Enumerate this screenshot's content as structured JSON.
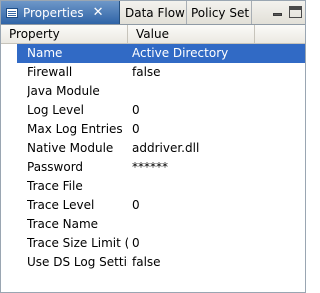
{
  "tabs": [
    {
      "label": "Properties",
      "active": true
    },
    {
      "label": "Data Flow",
      "active": false
    },
    {
      "label": "Policy Set",
      "active": false
    }
  ],
  "icons": {
    "properties": "properties-icon",
    "close": "close-icon",
    "minimize": "minimize-icon",
    "maximize": "maximize-icon"
  },
  "close_glyph": "✕",
  "table": {
    "columns": [
      "Property",
      "Value"
    ],
    "rows": [
      {
        "property": "Name",
        "value": "Active Directory",
        "selected": true
      },
      {
        "property": "Firewall",
        "value": "false"
      },
      {
        "property": "Java Module",
        "value": ""
      },
      {
        "property": "Log Level",
        "value": "0"
      },
      {
        "property": "Max Log Entries",
        "value": "0"
      },
      {
        "property": "Native Module",
        "value": "addriver.dll"
      },
      {
        "property": "Password",
        "value": "******"
      },
      {
        "property": "Trace File",
        "value": ""
      },
      {
        "property": "Trace Level",
        "value": "0"
      },
      {
        "property": "Trace Name",
        "value": ""
      },
      {
        "property": "Trace Size Limit (I",
        "value": "0"
      },
      {
        "property": "Use DS Log Settin",
        "value": "false"
      }
    ]
  },
  "colors": {
    "active_tab": "#2f64a7",
    "selection": "#316ac5"
  }
}
